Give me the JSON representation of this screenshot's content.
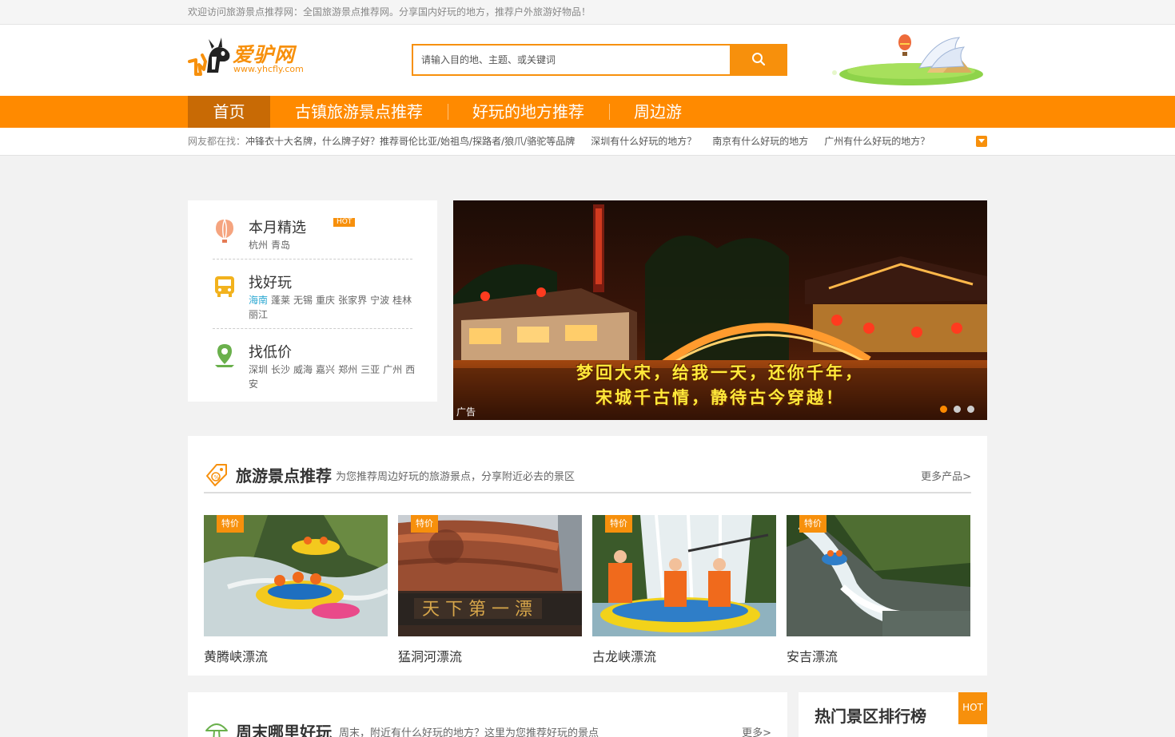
{
  "topbar": {
    "welcome": "欢迎访问旅游景点推荐网：全国旅游景点推荐网。分享国内好玩的地方，推荐户外旅游好物品！"
  },
  "header": {
    "logo_text": "爱驴网",
    "logo_url": "www.yhcfly.com",
    "search_placeholder": "请输入目的地、主题、或关键词"
  },
  "nav": {
    "items": [
      {
        "label": "首页",
        "active": true
      },
      {
        "label": "古镇旅游景点推荐"
      },
      {
        "label": "好玩的地方推荐"
      },
      {
        "label": "周边游"
      }
    ]
  },
  "hotsearch": {
    "prefix": "网友都在找：",
    "links": [
      "冲锋衣十大名牌，什么牌子好？推荐哥伦比亚/始祖鸟/探路者/狼爪/骆驼等品牌",
      "深圳有什么好玩的地方？",
      "南京有什么好玩的地方",
      "广州有什么好玩的地方？"
    ]
  },
  "categories": [
    {
      "title": "本月精选",
      "badge": "HOT",
      "icon": "balloon-icon",
      "links": [
        "杭州",
        "青岛"
      ]
    },
    {
      "title": "找好玩",
      "icon": "bus-icon",
      "links": [
        "海南",
        "蓬莱",
        "无锡",
        "重庆",
        "张家界",
        "宁波",
        "桂林",
        "丽江"
      ]
    },
    {
      "title": "找低价",
      "icon": "map-pin-icon",
      "links": [
        "深圳",
        "长沙",
        "威海",
        "嘉兴",
        "郑州",
        "三亚",
        "广州",
        "西安"
      ]
    }
  ],
  "banner": {
    "line1": "梦回大宋，给我一天，还你千年，",
    "line2": "宋城千古情，静待古今穿越！",
    "ad_label": "广告",
    "slide_count": 3,
    "active_slide": 1
  },
  "recommend": {
    "title": "旅游景点推荐",
    "subtitle": "为您推荐周边好玩的旅游景点，分享附近必去的景区",
    "more": "更多产品>",
    "tag_label": "特价",
    "items": [
      {
        "name": "黄腾峡漂流"
      },
      {
        "name": "猛洞河漂流"
      },
      {
        "name": "古龙峡漂流"
      },
      {
        "name": "安吉漂流"
      }
    ]
  },
  "weekend": {
    "title": "周末哪里好玩",
    "subtitle": "周末，附近有什么好玩的地方？这里为您推荐好玩的景点",
    "more": "更多>"
  },
  "ranking": {
    "title": "热门景区排行榜",
    "badge": "HOT"
  },
  "colors": {
    "accent": "#ff8a00",
    "nav_active": "#c86a05",
    "link_highlight": "#2ca8d2"
  }
}
